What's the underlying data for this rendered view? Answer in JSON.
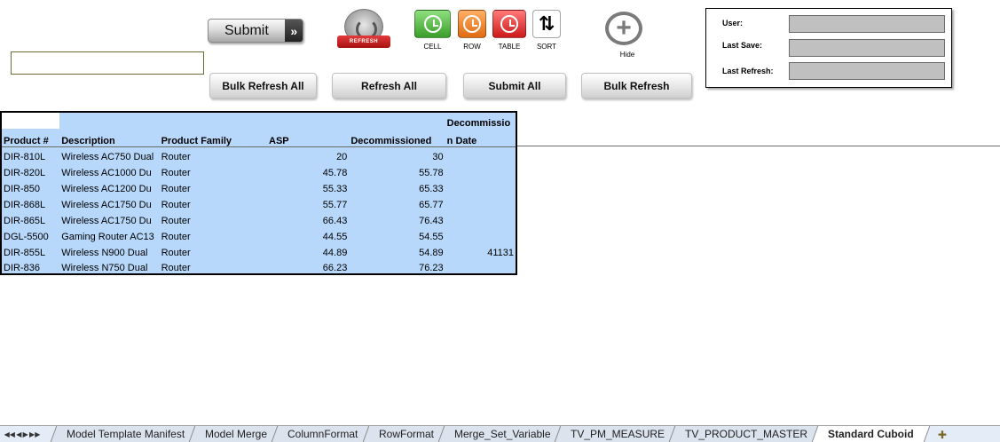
{
  "toolbar": {
    "name_input_value": "",
    "submit_label": "Submit",
    "submit_chevron": "»",
    "refresh_ribbon": "REFRESH",
    "cell_caption": "CELL",
    "row_caption": "ROW",
    "table_caption": "TABLE",
    "sort_caption": "SORT",
    "sort_glyph": "⇅",
    "hide_glyph": "+",
    "hide_caption": "Hide",
    "bulk_refresh_all_label": "Bulk Refresh All",
    "refresh_all_label": "Refresh All",
    "submit_all_label": "Submit All",
    "bulk_refresh_label": "Bulk Refresh"
  },
  "info": {
    "user_label": "User:",
    "last_save_label": "Last Save:",
    "last_refresh_label": "Last Refresh:",
    "user_value": "",
    "last_save_value": "",
    "last_refresh_value": ""
  },
  "table": {
    "header_top": [
      "",
      "",
      "",
      "",
      "",
      "Decommissio"
    ],
    "headers": [
      "Product #",
      "Description",
      "Product Family",
      "ASP",
      "Decommissioned",
      "n Date"
    ],
    "rows": [
      [
        "DIR-810L",
        "Wireless AC750 Dual",
        "Router",
        "20",
        "30",
        ""
      ],
      [
        "DIR-820L",
        "Wireless AC1000 Du",
        "Router",
        "45.78",
        "55.78",
        ""
      ],
      [
        "DIR-850",
        "Wireless AC1200 Du",
        "Router",
        "55.33",
        "65.33",
        ""
      ],
      [
        "DIR-868L",
        "Wireless AC1750 Du",
        "Router",
        "55.77",
        "65.77",
        ""
      ],
      [
        "DIR-865L",
        "Wireless AC1750 Du",
        "Router",
        "66.43",
        "76.43",
        ""
      ],
      [
        "DGL-5500",
        "Gaming Router AC13",
        "Router",
        "44.55",
        "54.55",
        ""
      ],
      [
        "DIR-855L",
        "Wireless N900 Dual",
        "Router",
        "44.89",
        "54.89",
        "41131"
      ],
      [
        "DIR-836",
        "Wireless N750 Dual",
        "Router",
        "66.23",
        "76.23",
        ""
      ]
    ]
  },
  "tabs": {
    "nav": [
      "◀◀",
      "◀",
      "▶",
      "▶▶"
    ],
    "sheets": [
      "Model Template Manifest",
      "Model Merge",
      "ColumnFormat",
      "RowFormat",
      "Merge_Set_Variable",
      "TV_PM_MEASURE",
      "TV_PRODUCT_MASTER",
      "Standard Cuboid"
    ],
    "active": "Standard Cuboid",
    "add_glyph": "✚"
  },
  "colors": {
    "table_fill": "#b8d8fb",
    "cell_tile": "#3a9d2a",
    "row_tile": "#e06a10",
    "table_tile": "#cc1a1a",
    "refresh_ribbon": "#c01a1a",
    "info_field": "#c0c0c0"
  }
}
